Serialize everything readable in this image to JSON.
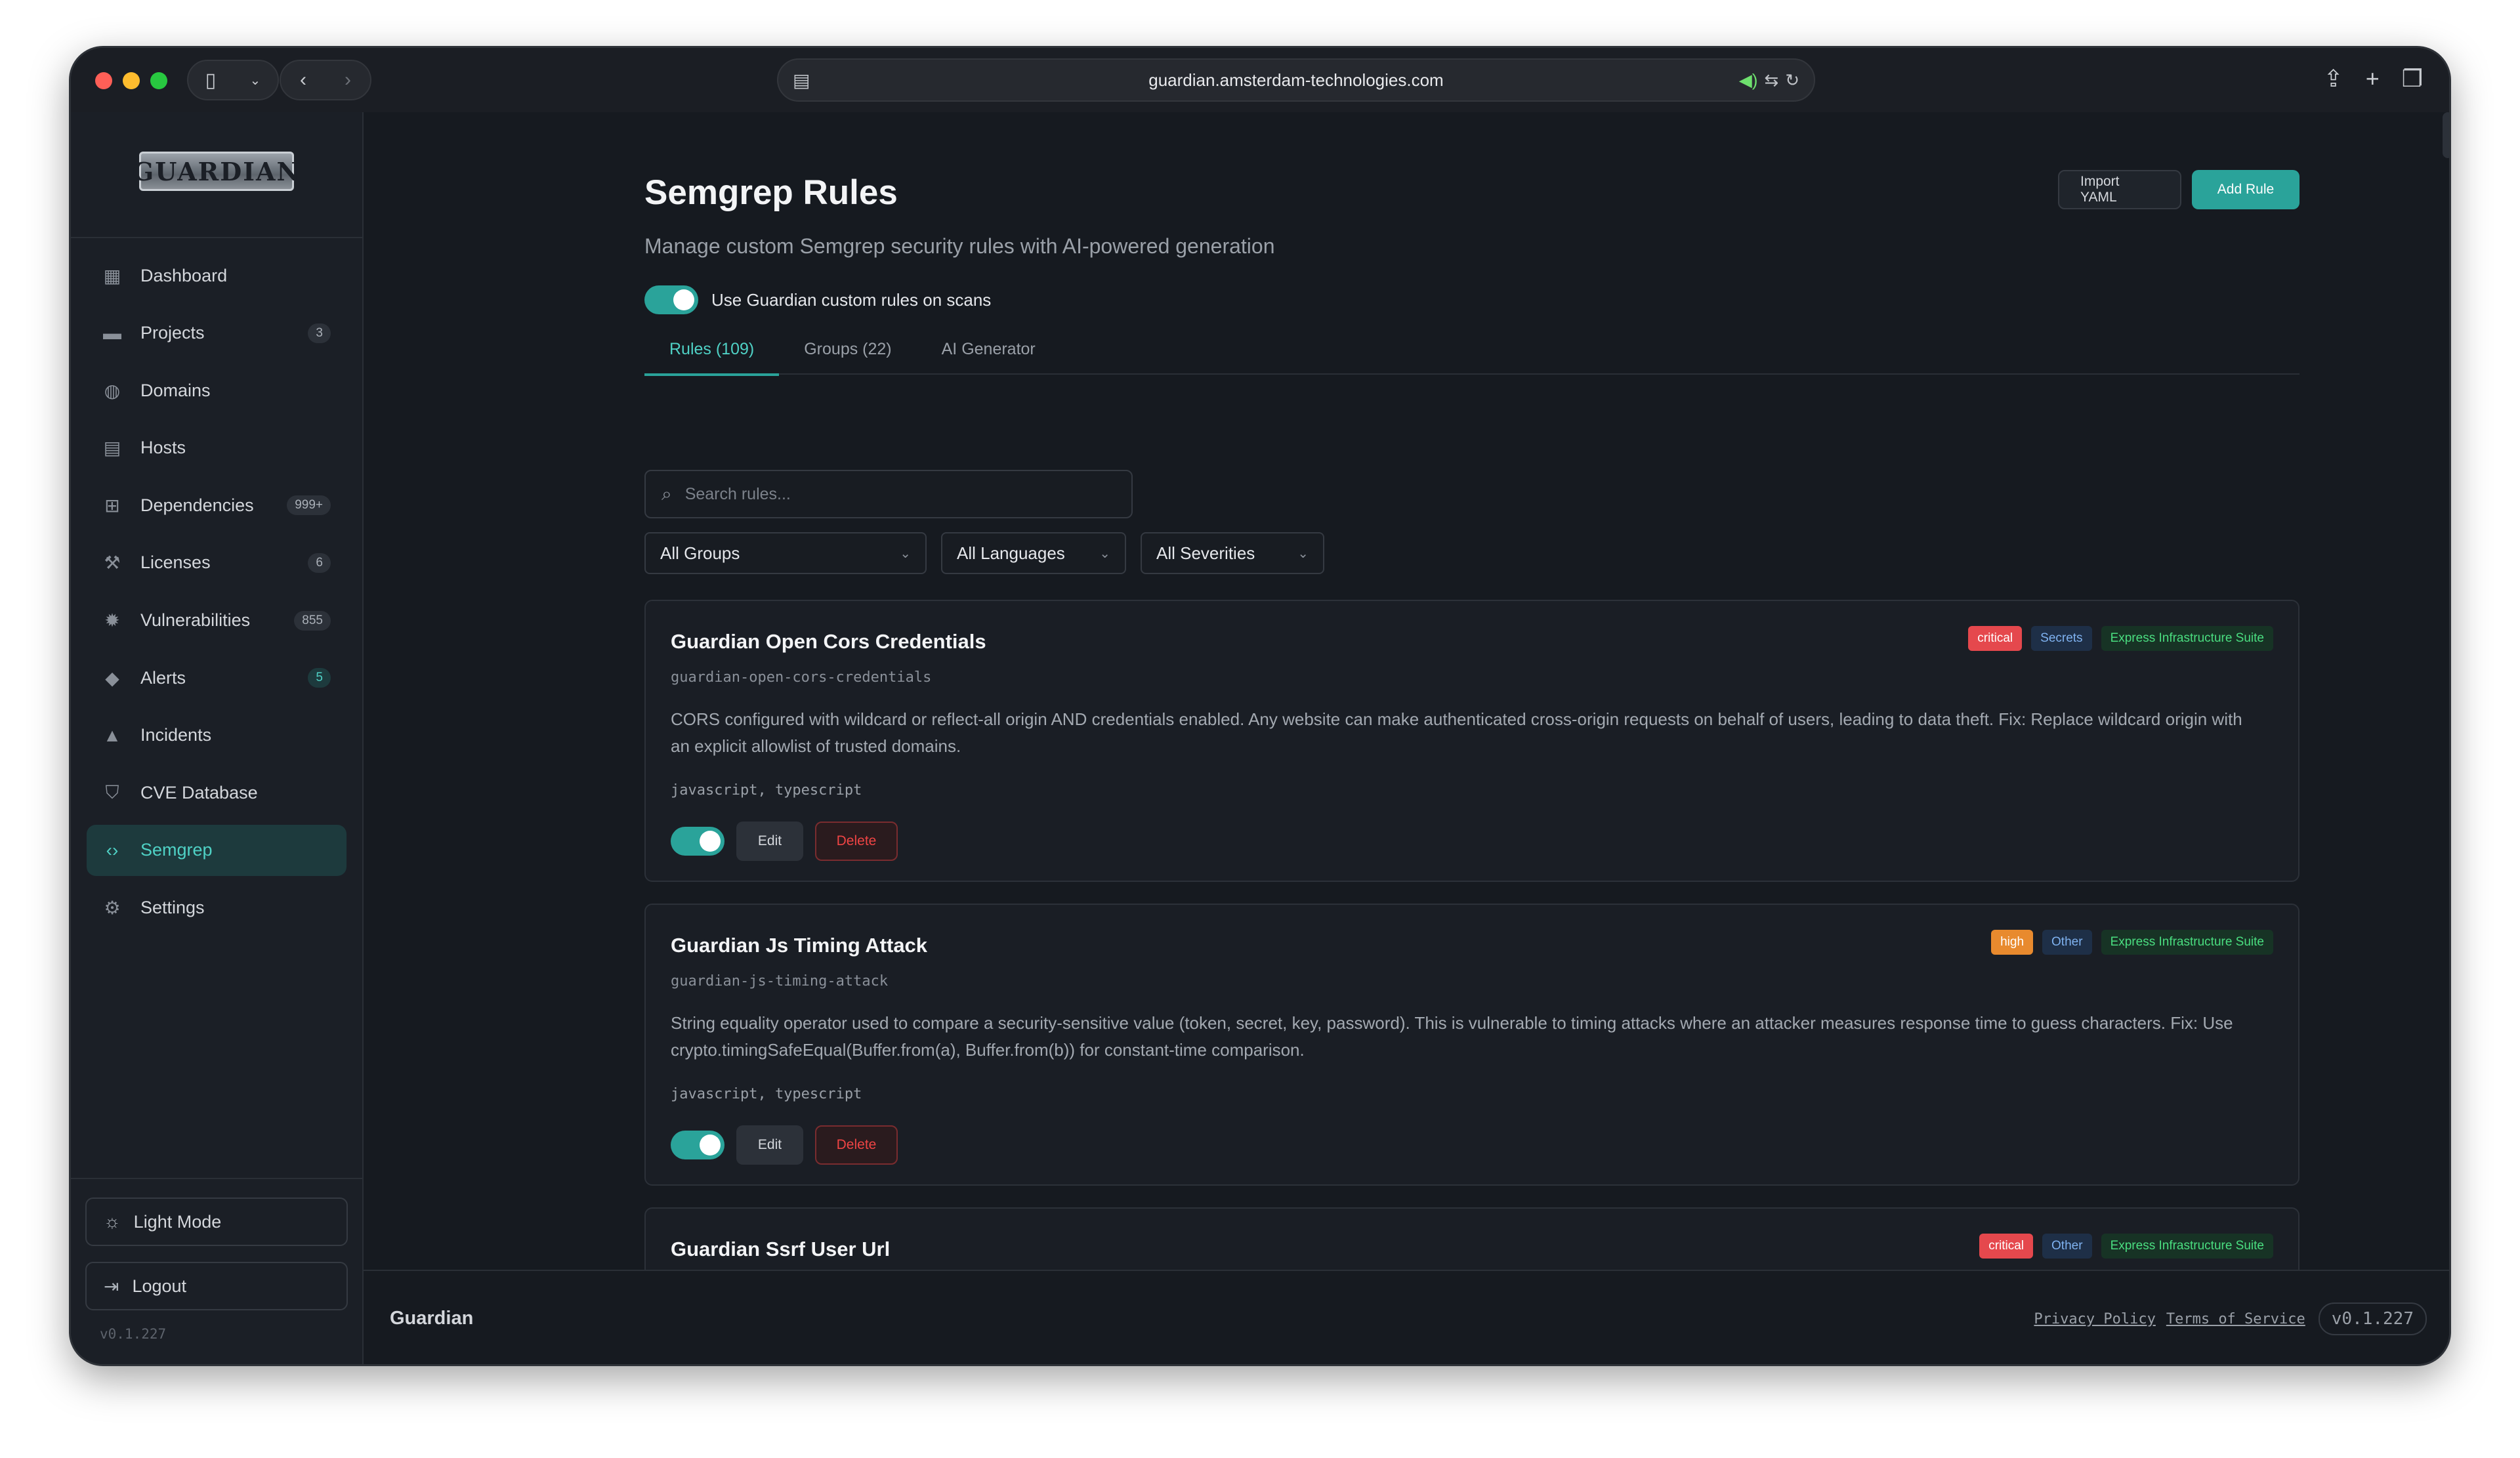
{
  "browser": {
    "url": "guardian.amsterdam-technologies.com"
  },
  "sidebar": {
    "logo_text": "GUARDIAN",
    "items": [
      {
        "label": "Dashboard",
        "icon": "dashboard-icon",
        "glyph": "▦",
        "badge": ""
      },
      {
        "label": "Projects",
        "icon": "folder-icon",
        "glyph": "▬",
        "badge": "3"
      },
      {
        "label": "Domains",
        "icon": "globe-icon",
        "glyph": "◍",
        "badge": ""
      },
      {
        "label": "Hosts",
        "icon": "server-icon",
        "glyph": "▤",
        "badge": ""
      },
      {
        "label": "Dependencies",
        "icon": "dependency-tree-icon",
        "glyph": "⊞",
        "badge": "999+"
      },
      {
        "label": "Licenses",
        "icon": "gavel-icon",
        "glyph": "⚒",
        "badge": "6"
      },
      {
        "label": "Vulnerabilities",
        "icon": "bug-icon",
        "glyph": "✹",
        "badge": "855"
      },
      {
        "label": "Alerts",
        "icon": "bell-icon",
        "glyph": "◆",
        "badge": "5"
      },
      {
        "label": "Incidents",
        "icon": "warning-icon",
        "glyph": "▲",
        "badge": ""
      },
      {
        "label": "CVE Database",
        "icon": "shield-icon",
        "glyph": "⛉",
        "badge": ""
      },
      {
        "label": "Semgrep",
        "icon": "code-icon",
        "glyph": "‹›",
        "badge": ""
      },
      {
        "label": "Settings",
        "icon": "gear-icon",
        "glyph": "⚙",
        "badge": ""
      }
    ],
    "light_mode_label": "Light Mode",
    "logout_label": "Logout",
    "version": "v0.1.227"
  },
  "header": {
    "title": "Semgrep Rules",
    "subtitle": "Manage custom Semgrep security rules with AI-powered generation",
    "import_label": "Import YAML",
    "add_label": "Add Rule",
    "toggle_label": "Use Guardian custom rules on scans"
  },
  "tabs": [
    {
      "label": "Rules (109)"
    },
    {
      "label": "Groups (22)"
    },
    {
      "label": "AI Generator"
    }
  ],
  "search": {
    "placeholder": "Search rules..."
  },
  "filters": {
    "groups": "All Groups",
    "languages": "All Languages",
    "severities": "All Severities"
  },
  "rules": [
    {
      "title": "Guardian Open Cors Credentials",
      "id": "guardian-open-cors-credentials",
      "description": "CORS configured with wildcard or reflect-all origin AND credentials enabled. Any website can make authenticated cross-origin requests on behalf of users, leading to data theft. Fix: Replace wildcard origin with an explicit allowlist of trusted domains.",
      "languages": "javascript, typescript",
      "severity": "critical",
      "category": "Secrets",
      "suite": "Express Infrastructure Suite",
      "edit_label": "Edit",
      "delete_label": "Delete"
    },
    {
      "title": "Guardian Js Timing Attack",
      "id": "guardian-js-timing-attack",
      "description": "String equality operator used to compare a security-sensitive value (token, secret, key, password). This is vulnerable to timing attacks where an attacker measures response time to guess characters. Fix: Use crypto.timingSafeEqual(Buffer.from(a), Buffer.from(b)) for constant-time comparison.",
      "languages": "javascript, typescript",
      "severity": "high",
      "category": "Other",
      "suite": "Express Infrastructure Suite",
      "edit_label": "Edit",
      "delete_label": "Delete"
    },
    {
      "title": "Guardian Ssrf User Url",
      "id": "guardian-ssrf-user-url",
      "severity": "critical",
      "category": "Other",
      "suite": "Express Infrastructure Suite"
    }
  ],
  "footer": {
    "brand": "Guardian",
    "privacy": "Privacy Policy",
    "terms": "Terms of Service",
    "version": "v0.1.227"
  },
  "colors": {
    "accent": "#2aa39a",
    "critical": "#e5484d",
    "high": "#e88a2e"
  }
}
